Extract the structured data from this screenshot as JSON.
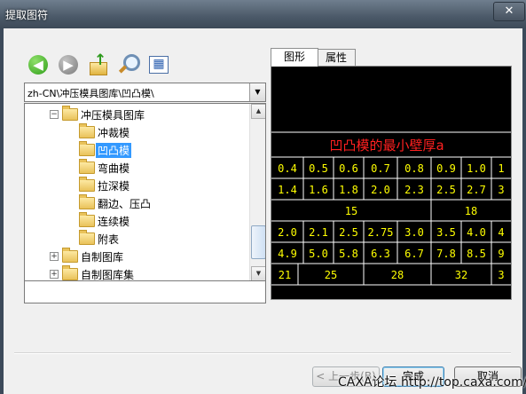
{
  "window": {
    "title": "提取图符",
    "close_glyph": "✕"
  },
  "toolbar": {
    "back_glyph": "◀",
    "forward_glyph": "▶",
    "up_glyph": "↑",
    "search_glyph": "⌕",
    "view_glyph": "▦"
  },
  "path": {
    "value": "zh-CN\\冲压模具图库\\凹凸模\\",
    "dropdown_glyph": "▼"
  },
  "tree": {
    "items": [
      {
        "label": "冲压模具图库",
        "expander": "−"
      },
      {
        "label": "冲裁模"
      },
      {
        "label": "凹凸模",
        "selected": true
      },
      {
        "label": "弯曲模"
      },
      {
        "label": "拉深模"
      },
      {
        "label": "翻边、压凸"
      },
      {
        "label": "连续模"
      },
      {
        "label": "附表"
      },
      {
        "label": "自制图库",
        "expander": "+"
      },
      {
        "label": "自制图库集",
        "expander": "+"
      }
    ],
    "scroll_up_glyph": "▲",
    "scroll_down_glyph": "▼"
  },
  "tabs": {
    "graphic": "图形",
    "properties": "属性"
  },
  "preview": {
    "title": "凹凸模的最小壁厚a",
    "rows": [
      [
        "0.4",
        "0.5",
        "0.6",
        "0.7",
        "0.8",
        "0.9",
        "1.0",
        "1"
      ],
      [
        "1.4",
        "1.6",
        "1.8",
        "2.0",
        "2.3",
        "2.5",
        "2.7",
        "3"
      ],
      [
        "15",
        "18"
      ],
      [
        "2.0",
        "2.1",
        "2.5",
        "2.75",
        "3.0",
        "3.5",
        "4.0",
        "4"
      ],
      [
        "4.9",
        "5.0",
        "5.8",
        "6.3",
        "6.7",
        "7.8",
        "8.5",
        "9"
      ],
      [
        "21",
        "25",
        "28",
        "32",
        "3"
      ]
    ],
    "colors": {
      "line": "#ffffff",
      "title": "#ff2020",
      "text": "#ffff00",
      "bg": "#000000"
    }
  },
  "buttons": {
    "prev": "< 上一步(B)",
    "finish": "完成",
    "cancel": "取消"
  },
  "watermark": "CAXA论坛 http://top.caxa.com/"
}
